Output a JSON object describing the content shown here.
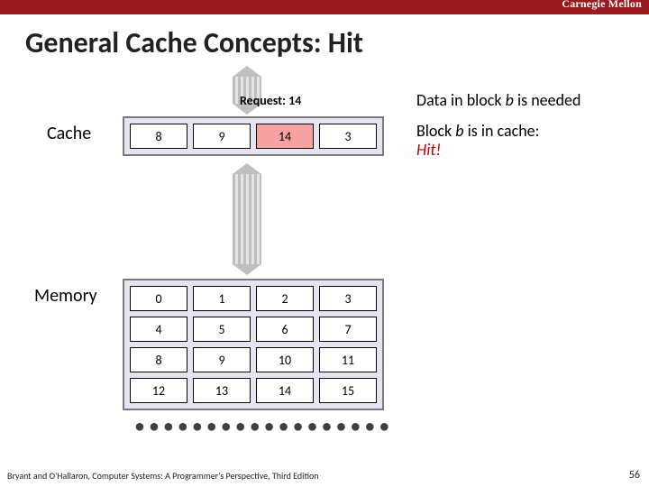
{
  "branding": {
    "org": "Carnegie Mellon"
  },
  "title": "General Cache Concepts: Hit",
  "request": {
    "label": "Request: 14"
  },
  "labels": {
    "cache": "Cache",
    "memory": "Memory"
  },
  "narration": {
    "line1_pre": "Data in block ",
    "line1_var": "b",
    "line1_post": " is needed",
    "line2_pre": "Block ",
    "line2_var": "b",
    "line2_post": " is in cache:",
    "line2_hit": "Hit!"
  },
  "cache": {
    "cells": [
      "8",
      "9",
      "14",
      "3"
    ],
    "highlight_index": 2
  },
  "memory": {
    "cells": [
      "0",
      "1",
      "2",
      "3",
      "4",
      "5",
      "6",
      "7",
      "8",
      "9",
      "10",
      "11",
      "12",
      "13",
      "14",
      "15"
    ]
  },
  "more_dots": "••••••••••••••••••",
  "footer": {
    "left": "Bryant and O'Hallaron, Computer Systems: A Programmer's Perspective, Third Edition",
    "page": "56"
  }
}
